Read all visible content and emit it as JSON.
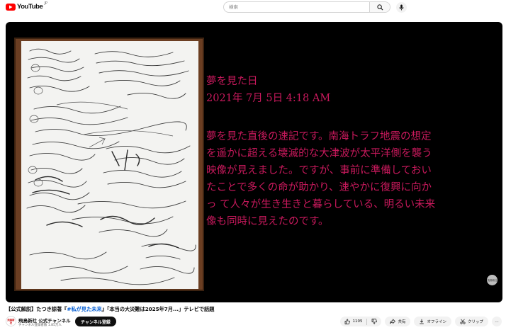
{
  "header": {
    "logo_text": "YouTube",
    "logo_region": "JP",
    "search_placeholder": "検索"
  },
  "player": {
    "overlay_title": "夢を見た日",
    "overlay_date": "2021年 7月 5日  4:18 AM",
    "overlay_lines": [
      "夢を見た直後の速記です。南海トラフ地震の想定",
      "を遥かに超える壊滅的な大津波が太平洋側を襲う",
      " 映像が見えました。ですが、事前に準備しておい",
      "たことで多くの命が助かり、速やかに復興に向か",
      "っ て人々が生き生きと暮らしている、明るい未来",
      "像も同時に見えたのです。"
    ],
    "watermark_text": "飛鳥新社"
  },
  "video": {
    "title_prefix": "【公式解説】たつき諒著『",
    "title_hashtag": "#私が見た未来",
    "title_suffix": "』「本当の大災難は2025年7月...」テレビで話題"
  },
  "channel": {
    "avatar_text": "飛鳥新社",
    "name": "飛鳥新社 公式チャンネル",
    "subscribers": "チャンネル登録者数 1.85万人",
    "subscribe_label": "チャンネル登録"
  },
  "actions": {
    "like_count": "1105",
    "share_label": "共有",
    "offline_label": "オフライン",
    "clip_label": "クリップ",
    "more_label": "…"
  }
}
